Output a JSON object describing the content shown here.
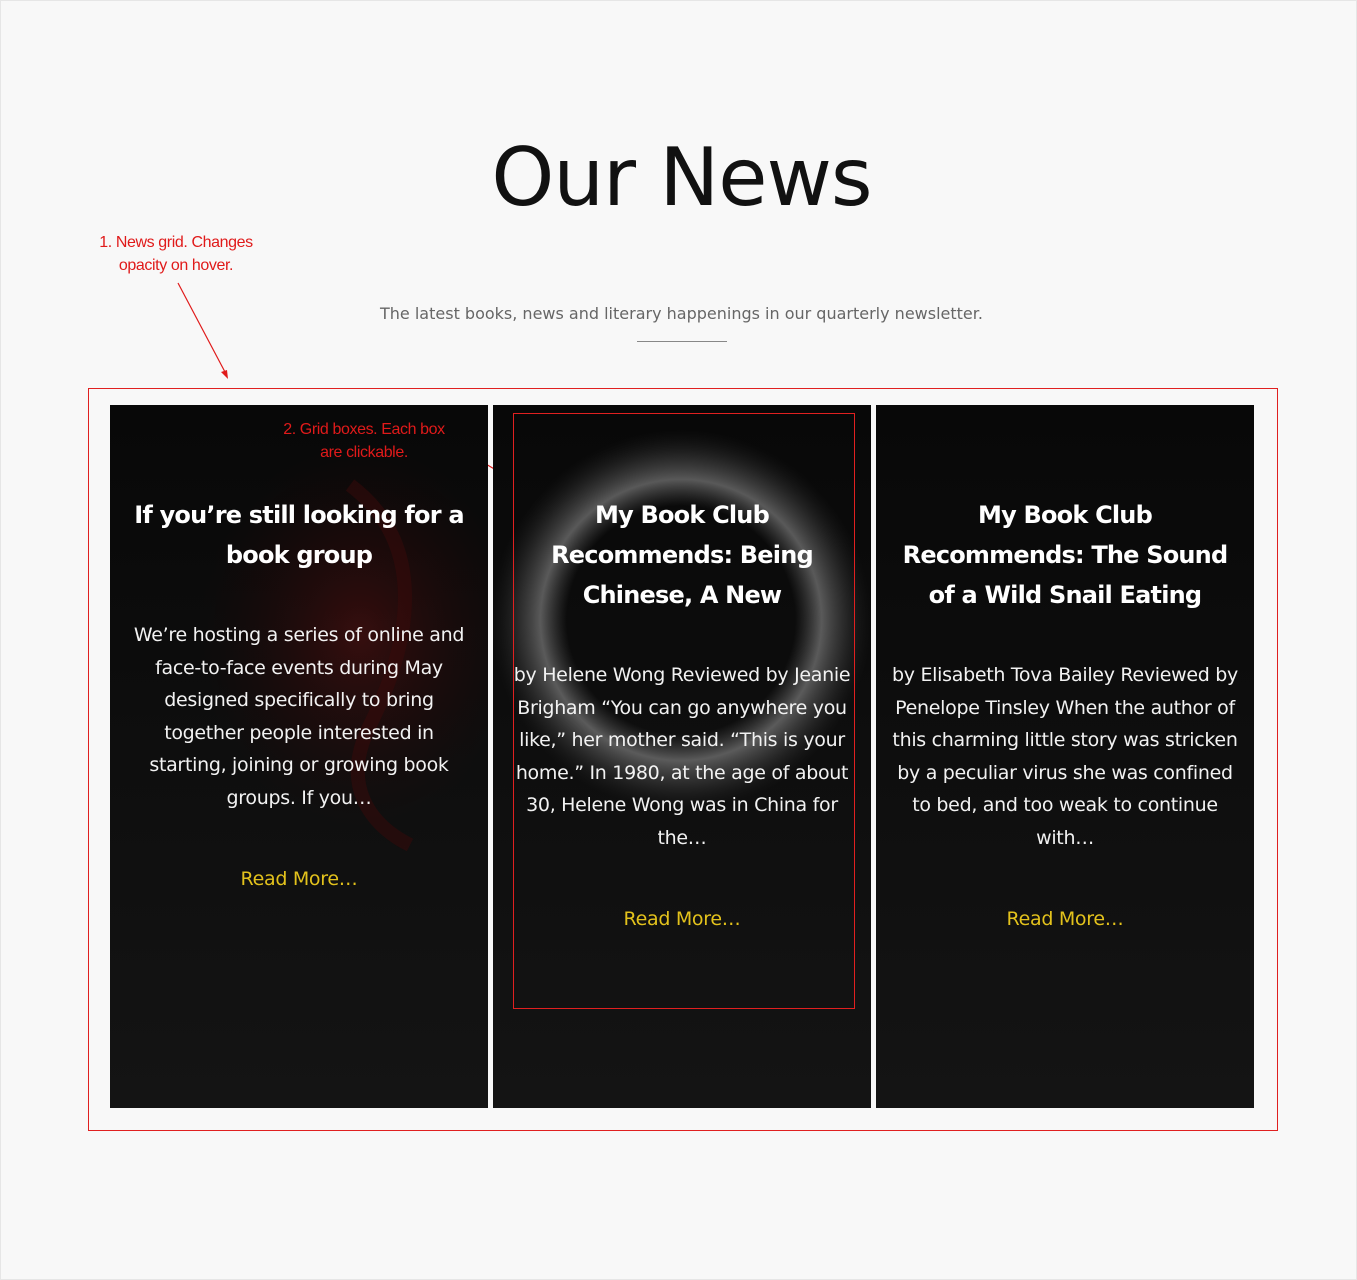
{
  "section": {
    "title": "Our News",
    "subtitle": "The latest books, news and literary happenings in our quarterly newsletter."
  },
  "annotations": {
    "grid_note": "1. News grid. Changes opacity on hover.",
    "box_note": "2. Grid boxes. Each box are clickable."
  },
  "cards": [
    {
      "title": "If you’re still looking for a book group",
      "excerpt": "We’re hosting a series of online and face-to-face events during May designed specifically to bring together people interested in starting, joining or growing book groups. If you…",
      "link": "Read More…"
    },
    {
      "title": "My Book Club Recommends: Being Chinese, A New",
      "excerpt": "by Helene Wong Reviewed by Jeanie Brigham “You can go anywhere you like,” her mother said. “This is your home.” In 1980, at the age of about 30, Helene Wong was in China for the…",
      "link": "Read More…"
    },
    {
      "title": "My Book Club Recommends: The Sound of a Wild Snail Eating",
      "excerpt": "by Elisabeth Tova Bailey Reviewed by Penelope Tinsley When the author of this charming little story was stricken by a peculiar virus she was confined to bed, and too weak to continue with…",
      "link": "Read More…"
    }
  ],
  "colors": {
    "page_background": "#f8f8f8",
    "card_background": "#0e0e0e",
    "link_color": "#e3c21c",
    "annotation_color": "#e01a1a"
  }
}
